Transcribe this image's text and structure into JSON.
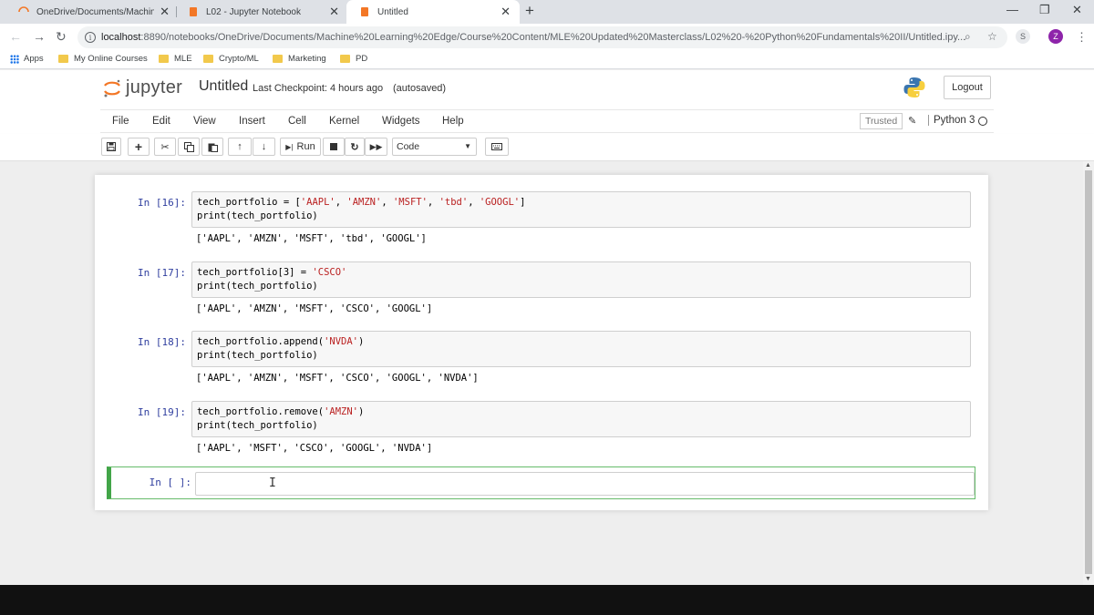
{
  "browser": {
    "tabs": [
      {
        "title": "OneDrive/Documents/Machine L",
        "active": false
      },
      {
        "title": "L02 - Jupyter Notebook",
        "active": false
      },
      {
        "title": "Untitled",
        "active": true
      }
    ],
    "new_tab": "+",
    "close_glyph": "✕",
    "window_controls": {
      "minimize": "—",
      "restore": "❐",
      "close": "✕"
    },
    "url_host": "localhost",
    "url_path": ":8890/notebooks/OneDrive/Documents/Machine%20Learning%20Edge/Course%20Content/MLE%20Updated%20Masterclass/L02%20-%20Python%20Fundamentals%20II/Untitled.ipy...",
    "bookmarks": [
      "Apps",
      "My Online Courses",
      "MLE",
      "Crypto/ML",
      "Marketing",
      "PD"
    ],
    "profile_initial": "Z"
  },
  "jupyter": {
    "logo_text": "jupyter",
    "notebook_name": "Untitled",
    "checkpoint": "Last Checkpoint: 4 hours ago",
    "autosave": "(autosaved)",
    "logout_label": "Logout",
    "menu": [
      "File",
      "Edit",
      "View",
      "Insert",
      "Cell",
      "Kernel",
      "Widgets",
      "Help"
    ],
    "trusted_label": "Trusted",
    "kernel_name": "Python 3",
    "toolbar": {
      "run_label": "Run",
      "cell_type": "Code"
    }
  },
  "cells": [
    {
      "prompt": "In [16]:",
      "code": [
        "tech_portfolio = ['AAPL', 'AMZN', 'MSFT', 'tbd', 'GOOGL']",
        "print(tech_portfolio)"
      ],
      "output": "['AAPL', 'AMZN', 'MSFT', 'tbd', 'GOOGL']"
    },
    {
      "prompt": "In [17]:",
      "code": [
        "tech_portfolio[3] = 'CSCO'",
        "print(tech_portfolio)"
      ],
      "output": "['AAPL', 'AMZN', 'MSFT', 'CSCO', 'GOOGL']"
    },
    {
      "prompt": "In [18]:",
      "code": [
        "tech_portfolio.append('NVDA')",
        "print(tech_portfolio)"
      ],
      "output": "['AAPL', 'AMZN', 'MSFT', 'CSCO', 'GOOGL', 'NVDA']"
    },
    {
      "prompt": "In [19]:",
      "code": [
        "tech_portfolio.remove('AMZN')",
        "print(tech_portfolio)"
      ],
      "output": "['AAPL', 'MSFT', 'CSCO', 'GOOGL', 'NVDA']"
    }
  ],
  "empty_cell": {
    "prompt": "In [ ]:"
  },
  "colors": {
    "accent_green": "#42a548",
    "prompt_blue": "#303f9f",
    "string_red": "#ba2121"
  }
}
